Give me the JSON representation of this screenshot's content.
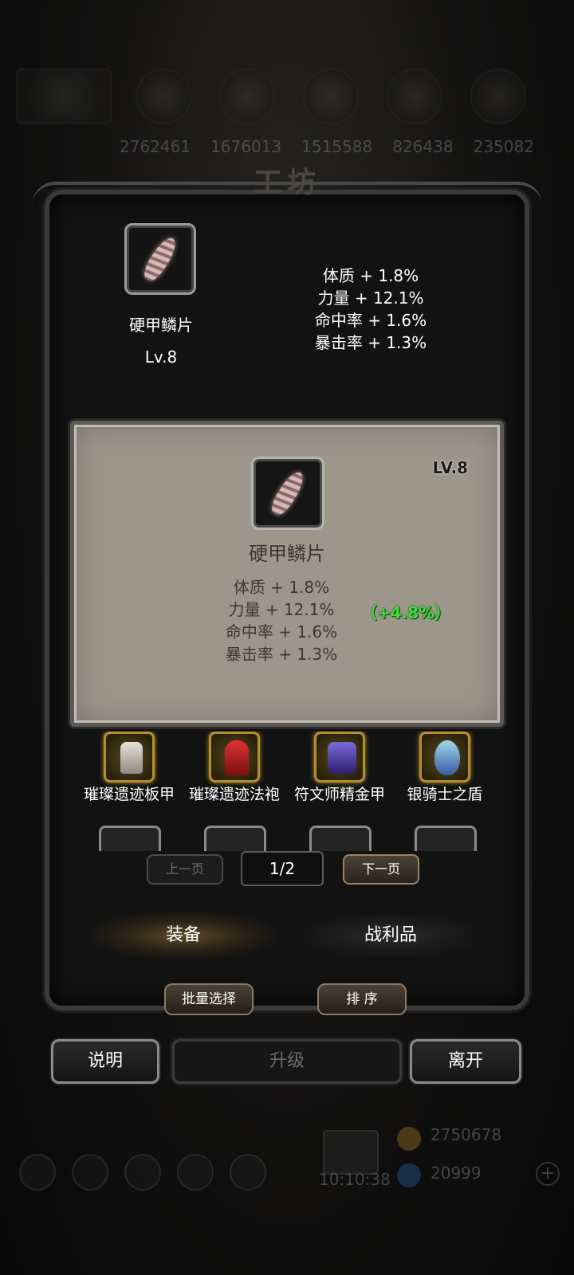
{
  "background": {
    "resource_values": [
      "2762461",
      "1676013",
      "1515588",
      "826438",
      "235082"
    ],
    "bottom": {
      "time": "10:10:38",
      "gold": "2750678",
      "gems": "20999"
    }
  },
  "window": {
    "title": "工坊"
  },
  "selected_item": {
    "name": "硬甲鳞片",
    "level": "Lv.8",
    "icon": "scale-feather-icon",
    "stats": [
      "体质 + 1.8%",
      "力量 + 12.1%",
      "命中率 + 1.6%",
      "暴击率 + 1.3%"
    ]
  },
  "detail_card": {
    "level": "LV.8",
    "name": "硬甲鳞片",
    "stats": [
      "体质 + 1.8%",
      "力量 + 12.1%",
      "命中率 + 1.6%",
      "暴击率 + 1.3%"
    ],
    "bonus": "（+4.8%）",
    "bonus_color": "#3ee03a"
  },
  "equipment_list": [
    {
      "name": "璀璨遗迹板甲",
      "icon": "plate-armor-icon"
    },
    {
      "name": "璀璨遗迹法袍",
      "icon": "red-robe-icon"
    },
    {
      "name": "符文师精金甲",
      "icon": "purple-armor-icon"
    },
    {
      "name": "银骑士之盾",
      "icon": "silver-shield-icon"
    }
  ],
  "pager": {
    "prev": "上一页",
    "page": "1/2",
    "next": "下一页"
  },
  "tabs": [
    {
      "label": "装备",
      "active": true
    },
    {
      "label": "战利品",
      "active": false
    }
  ],
  "toolbar": {
    "batch_select": "批量选择",
    "sort": "排 序"
  },
  "actions": {
    "help": "说明",
    "upgrade": "升级",
    "leave": "离开"
  },
  "colors": {
    "card_bg": "#9d978b",
    "gold_border": "#b58f2e",
    "panel_bg": "#121212"
  }
}
